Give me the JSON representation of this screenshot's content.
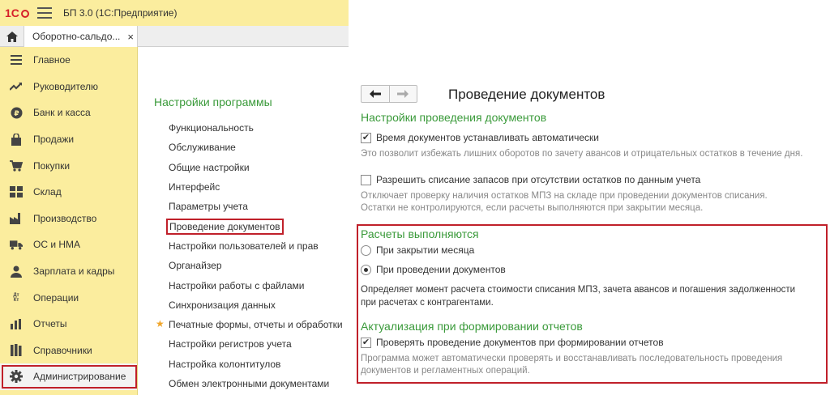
{
  "app": {
    "title": "БП 3.0  (1С:Предприятие)",
    "tab": {
      "label": "Оборотно-сальдо...",
      "close": "×"
    }
  },
  "sidebar": {
    "items": [
      {
        "label": "Главное",
        "icon": "menu-icon"
      },
      {
        "label": "Руководителю",
        "icon": "trend-icon"
      },
      {
        "label": "Банк и касса",
        "icon": "ruble-icon"
      },
      {
        "label": "Продажи",
        "icon": "bag-icon"
      },
      {
        "label": "Покупки",
        "icon": "cart-icon"
      },
      {
        "label": "Склад",
        "icon": "warehouse-icon"
      },
      {
        "label": "Производство",
        "icon": "factory-icon"
      },
      {
        "label": "ОС и НМА",
        "icon": "truck-icon"
      },
      {
        "label": "Зарплата и кадры",
        "icon": "person-icon"
      },
      {
        "label": "Операции",
        "icon": "dt-kt-icon",
        "glyph": "Дт\nКт"
      },
      {
        "label": "Отчеты",
        "icon": "bar-chart-icon"
      },
      {
        "label": "Справочники",
        "icon": "books-icon"
      },
      {
        "label": "Администрирование",
        "icon": "gear-icon"
      }
    ],
    "active_index": 12
  },
  "settings": {
    "title": "Настройки программы",
    "items": [
      "Функциональность",
      "Обслуживание",
      "Общие настройки",
      "Интерфейс",
      "Параметры учета",
      "Проведение документов",
      "Настройки пользователей и прав",
      "Органайзер",
      "Настройки работы с файлами",
      "Синхронизация данных",
      "Печатные формы, отчеты и обработки",
      "Настройки регистров учета",
      "Настройка колонтитулов",
      "Обмен электронными документами"
    ],
    "highlight_index": 5,
    "star_index": 10
  },
  "detail": {
    "title": "Проведение документов",
    "nav": {
      "back": "🡐",
      "forward": "🡒"
    },
    "section1": {
      "title": "Настройки проведения документов",
      "opt1": {
        "label": "Время документов устанавливать автоматически",
        "checked": true
      },
      "hint1": "Это позволит избежать лишних оборотов по зачету авансов и отрицательных остатков в течение дня.",
      "opt2": {
        "label": "Разрешить списание запасов при отсутствии остатков по данным учета",
        "checked": false
      },
      "hint2_line1": "Отключает проверку наличия остатков МПЗ на складе при проведении документов списания.",
      "hint2_line2": "Остатки не контролируются, если расчеты выполняются при закрытии месяца."
    },
    "section2": {
      "title": "Расчеты выполняются",
      "radio1": {
        "label": "При закрытии месяца",
        "selected": false
      },
      "radio2": {
        "label": "При проведении документов",
        "selected": true
      },
      "desc_line1": "Определяет момент расчета стоимости списания МПЗ, зачета авансов и погашения задолженности",
      "desc_line2": "при расчетах с контрагентами."
    },
    "section3": {
      "title": "Актуализация при формировании отчетов",
      "opt": {
        "label": "Проверять проведение документов при формировании отчетов",
        "checked": true
      },
      "hint_line1": "Программа может автоматически проверять и восстанавливать последовательность проведения",
      "hint_line2": "документов и регламентных операций."
    }
  },
  "colors": {
    "sidebar_bg": "#fbed9e",
    "accent_green": "#3a9a3a",
    "highlight_red": "#c0202a"
  }
}
